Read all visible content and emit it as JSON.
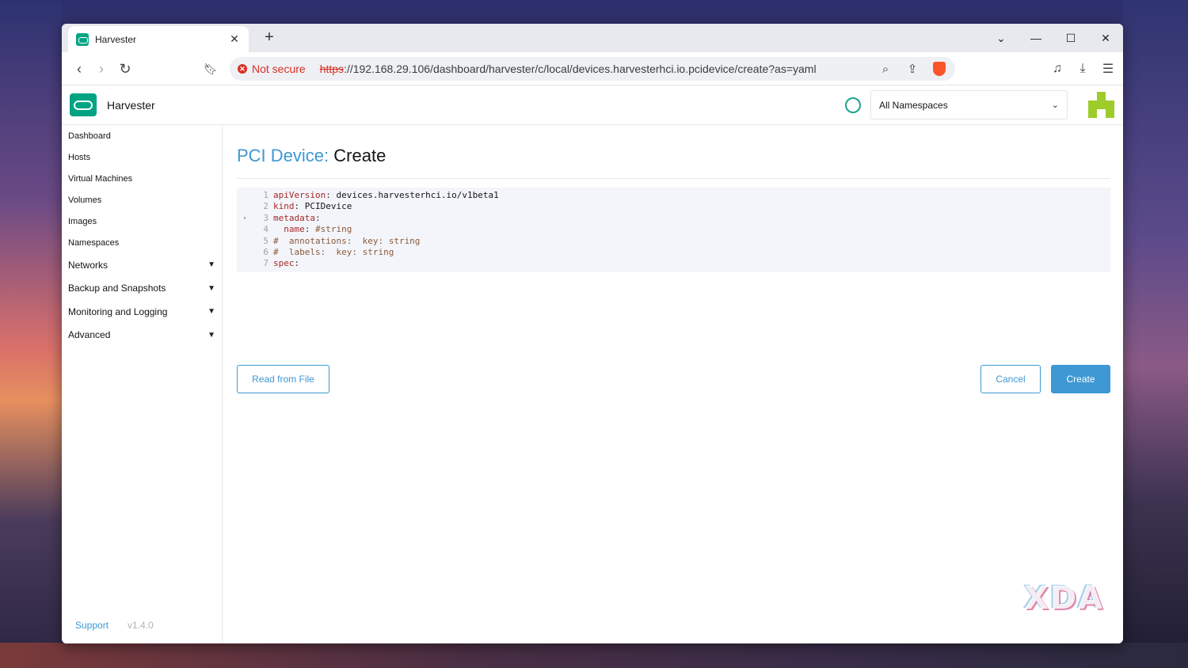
{
  "browser": {
    "tab_title": "Harvester",
    "new_tab": "+",
    "security_label": "Not secure",
    "url_scheme": "https",
    "url_rest": "://192.168.29.106/dashboard/harvester/c/local/devices.harvesterhci.io.pcidevice/create?as=yaml"
  },
  "header": {
    "app_name": "Harvester",
    "namespace_select": "All Namespaces"
  },
  "sidebar": {
    "items": [
      "Dashboard",
      "Hosts",
      "Virtual Machines",
      "Volumes",
      "Images",
      "Namespaces"
    ],
    "groups": [
      "Networks",
      "Backup and Snapshots",
      "Monitoring and Logging",
      "Advanced"
    ],
    "support": "Support",
    "version": "v1.4.0"
  },
  "main": {
    "heading_prefix": "PCI Device:",
    "heading_title": "Create",
    "buttons": {
      "read_from_file": "Read from File",
      "cancel": "Cancel",
      "create": "Create"
    }
  },
  "editor": {
    "lines": [
      {
        "num": "1",
        "fold": "",
        "parts": [
          {
            "t": "key",
            "v": "apiVersion"
          },
          {
            "t": "punct",
            "v": ": "
          },
          {
            "t": "val",
            "v": "devices.harvesterhci.io/v1beta1"
          }
        ]
      },
      {
        "num": "2",
        "fold": "",
        "parts": [
          {
            "t": "key",
            "v": "kind"
          },
          {
            "t": "punct",
            "v": ": "
          },
          {
            "t": "val",
            "v": "PCIDevice"
          }
        ]
      },
      {
        "num": "3",
        "fold": "▾",
        "parts": [
          {
            "t": "key",
            "v": "metadata"
          },
          {
            "t": "punct",
            "v": ":"
          }
        ]
      },
      {
        "num": "4",
        "fold": "",
        "parts": [
          {
            "t": "val",
            "v": "  "
          },
          {
            "t": "key",
            "v": "name"
          },
          {
            "t": "punct",
            "v": ": "
          },
          {
            "t": "comment",
            "v": "#string"
          }
        ]
      },
      {
        "num": "5",
        "fold": "",
        "parts": [
          {
            "t": "comment",
            "v": "#  annotations:  key: string"
          }
        ]
      },
      {
        "num": "6",
        "fold": "",
        "parts": [
          {
            "t": "comment",
            "v": "#  labels:  key: string"
          }
        ]
      },
      {
        "num": "7",
        "fold": "",
        "parts": [
          {
            "t": "key",
            "v": "spec"
          },
          {
            "t": "punct",
            "v": ":"
          }
        ]
      }
    ]
  },
  "watermark": "XDA",
  "colors": {
    "accent": "#3d98d3",
    "brand": "#00a483",
    "danger": "#d93025"
  }
}
